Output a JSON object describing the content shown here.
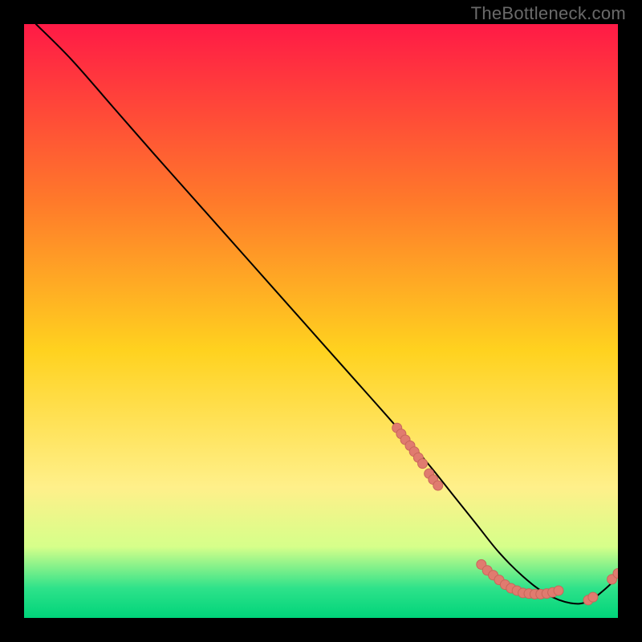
{
  "watermark": "TheBottleneck.com",
  "colors": {
    "bg": "#000000",
    "curve": "#000000",
    "dot_fill": "#e07b6f",
    "dot_stroke": "#c9665a",
    "gradient": {
      "top": "#ff1a46",
      "mid_upper": "#ff7a2a",
      "mid": "#ffd21f",
      "mid_low1": "#fff08a",
      "mid_low2": "#d6ff8a",
      "low": "#2ee28a",
      "bottom": "#00d47a"
    }
  },
  "chart_data": {
    "type": "line",
    "title": "",
    "xlabel": "",
    "ylabel": "",
    "xlim": [
      0,
      100
    ],
    "ylim": [
      0,
      100
    ],
    "series": [
      {
        "name": "curve",
        "x": [
          2,
          8,
          15,
          22,
          30,
          38,
          46,
          54,
          62,
          68,
          72,
          76,
          80,
          84,
          88,
          92,
          95,
          98,
          100
        ],
        "y": [
          100,
          94,
          86,
          78,
          69,
          60,
          51,
          42,
          33,
          26,
          21,
          16,
          11,
          7,
          4,
          2.5,
          2.8,
          5,
          7
        ]
      }
    ],
    "dot_clusters": [
      {
        "name": "upper-cluster",
        "points": [
          [
            62.8,
            32.0
          ],
          [
            63.5,
            31.0
          ],
          [
            64.2,
            30.0
          ],
          [
            65.0,
            29.0
          ],
          [
            65.7,
            28.0
          ],
          [
            66.4,
            27.0
          ],
          [
            67.1,
            26.0
          ],
          [
            68.2,
            24.3
          ],
          [
            68.9,
            23.3
          ],
          [
            69.7,
            22.3
          ]
        ]
      },
      {
        "name": "lower-cluster",
        "points": [
          [
            77.0,
            9.0
          ],
          [
            78.0,
            8.0
          ],
          [
            79.0,
            7.2
          ],
          [
            80.0,
            6.4
          ],
          [
            81.0,
            5.6
          ],
          [
            82.0,
            5.0
          ],
          [
            83.0,
            4.6
          ],
          [
            84.0,
            4.2
          ],
          [
            85.0,
            4.1
          ],
          [
            86.0,
            4.0
          ],
          [
            87.0,
            4.0
          ],
          [
            88.0,
            4.1
          ],
          [
            89.0,
            4.3
          ],
          [
            90.0,
            4.6
          ]
        ]
      },
      {
        "name": "right-pair",
        "points": [
          [
            95.0,
            3.0
          ],
          [
            95.8,
            3.5
          ]
        ]
      },
      {
        "name": "far-right",
        "points": [
          [
            99.0,
            6.5
          ],
          [
            100.0,
            7.5
          ]
        ]
      }
    ]
  }
}
